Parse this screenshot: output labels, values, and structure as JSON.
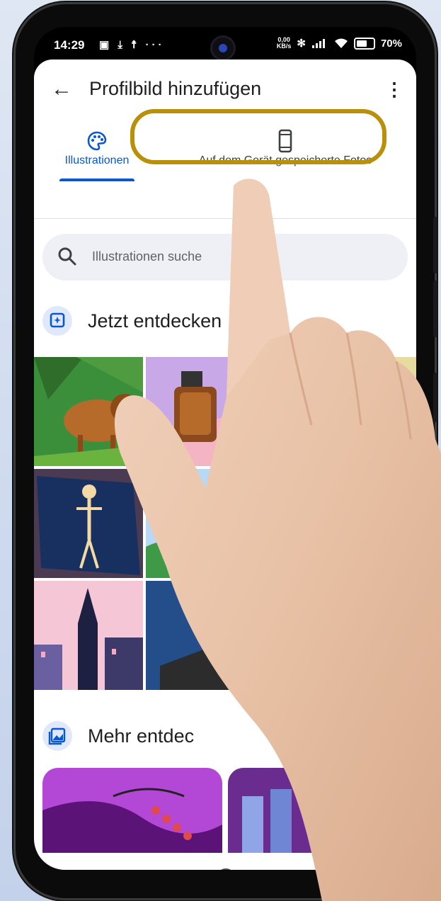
{
  "status_bar": {
    "time": "14:29",
    "left_icons": "▣ ⤓ ☨ ···",
    "net_speed_value": "0,00",
    "net_speed_unit": "KB/s",
    "battery": "70%"
  },
  "header": {
    "title": "Profilbild hinzufügen",
    "back_icon": "arrow-back-icon",
    "more_icon": "more-vert-icon"
  },
  "tabs": [
    {
      "label": "Illustrationen",
      "icon": "palette-icon",
      "selected": true
    },
    {
      "label": "Auf dem Gerät gespeicherte Fotos",
      "icon": "phone-icon",
      "selected": false
    }
  ],
  "search": {
    "placeholder": "Illustrationen suche"
  },
  "sections": [
    {
      "title": "Jetzt entdecken",
      "icon": "explore-icon"
    },
    {
      "title": "Mehr entdec",
      "icon": "image-gallery-icon"
    }
  ],
  "colors": {
    "accent": "#0b57d0",
    "highlight_ring": "#b8900a",
    "search_bg": "#eef0f5"
  },
  "navbar": {
    "icons": [
      "recents-icon",
      "home-icon",
      "back-icon"
    ]
  }
}
